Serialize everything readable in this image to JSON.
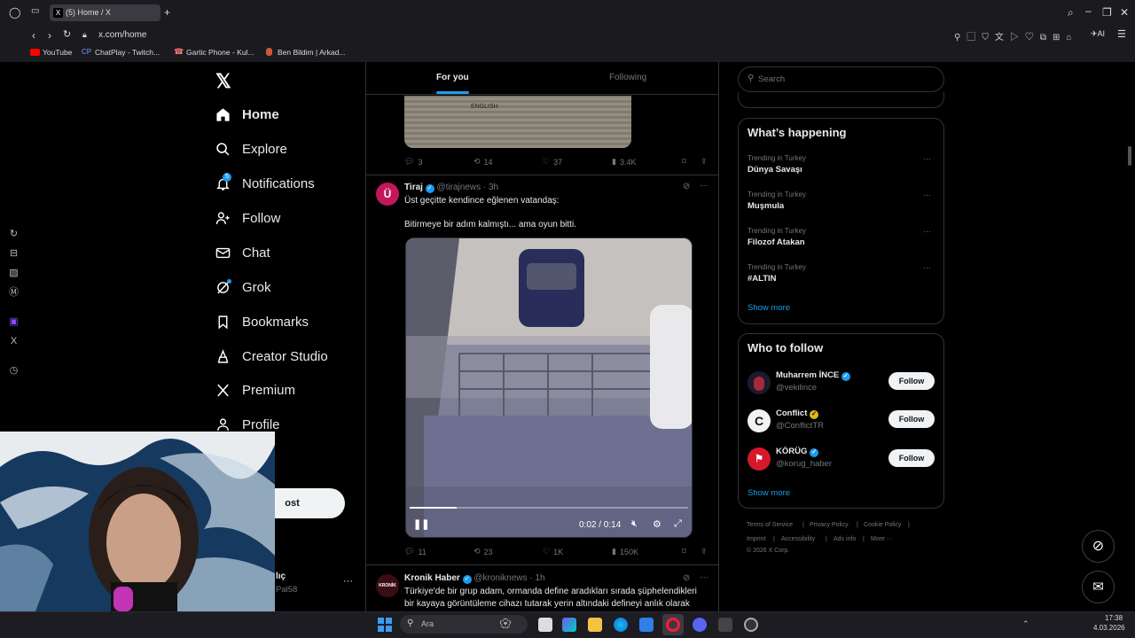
{
  "browser": {
    "tab_title": "(5) Home / X",
    "url": "x.com/home",
    "bookmarks": [
      "YouTube",
      "ChatPlay - Twitch...",
      "Gartic Phone - Kul...",
      "Ben Bildim | Arkad..."
    ]
  },
  "nav": {
    "items": [
      {
        "label": "Home",
        "icon": "home-icon"
      },
      {
        "label": "Explore",
        "icon": "search-icon"
      },
      {
        "label": "Notifications",
        "icon": "bell-icon",
        "badge": "5"
      },
      {
        "label": "Follow",
        "icon": "person-add-icon"
      },
      {
        "label": "Chat",
        "icon": "mail-icon"
      },
      {
        "label": "Grok",
        "icon": "grok-icon"
      },
      {
        "label": "Bookmarks",
        "icon": "bookmark-icon"
      },
      {
        "label": "Creator Studio",
        "icon": "creator-icon"
      },
      {
        "label": "Premium",
        "icon": "x-icon"
      },
      {
        "label": "Profile",
        "icon": "person-icon"
      }
    ],
    "post_button_partial": "ost",
    "account_name_partial": "lıç",
    "account_handle_partial": "Pal58"
  },
  "feed": {
    "tabs": [
      "For you",
      "Following"
    ],
    "prev_post_stats": {
      "replies": "3",
      "reposts": "14",
      "likes": "37",
      "views": "3.4K"
    },
    "posts": [
      {
        "author": "Tiraj",
        "handle": "@tirajnews",
        "time": "· 3h",
        "text_line1": "Üst geçitte kendince eğlenen vatandaş:",
        "text_line2": "Bitirmeye bir adım kalmıştı... ama oyun bitti.",
        "video_time": "0:02 / 0:14",
        "video_progress": 0.17,
        "stats": {
          "replies": "11",
          "reposts": "23",
          "likes": "1K",
          "views": "150K"
        }
      },
      {
        "author": "Kronik Haber",
        "handle": "@kroniknews",
        "time": "· 1h",
        "text_line1": "Türkiye'de bir grup adam, ormanda define aradıkları sırada şüphelendikleri",
        "text_line2": "bir kayaya görüntüleme cihazı tutarak yerin altındaki defineyi anlık olarak"
      }
    ]
  },
  "right": {
    "search_placeholder": "Search",
    "whats_happening": "What’s happening",
    "trends": [
      {
        "context": "Trending in Turkey",
        "title": "Dünya Savaşı"
      },
      {
        "context": "Trending in Turkey",
        "title": "Muşmula"
      },
      {
        "context": "Trending in Turkey",
        "title": "Filozof Atakan"
      },
      {
        "context": "Trending in Turkey",
        "title": "#ALTIN"
      }
    ],
    "show_more": "Show more",
    "who_to_follow": "Who to follow",
    "suggestions": [
      {
        "name": "Muharrem İNCE",
        "handle": "@vekilince",
        "verified": "blue"
      },
      {
        "name": "Conflict",
        "handle": "@ConflictTR",
        "verified": "gold"
      },
      {
        "name": "KÖRÜG",
        "handle": "@korug_haber",
        "verified": "blue"
      }
    ],
    "follow_label": "Follow",
    "footer": [
      "Terms of Service",
      "|",
      "Privacy Policy",
      "|",
      "Cookie Policy",
      "|",
      "Imprint",
      "|",
      "Accessibility",
      "|",
      "Ads info",
      "|",
      "More ···",
      "© 2026 X Corp."
    ]
  },
  "taskbar": {
    "search_placeholder": "Ara",
    "clock_time": "17:38",
    "clock_date": "4.03.2026"
  },
  "colors": {
    "accent": "#1d9bf0",
    "gold": "#e2b719",
    "border": "#2f3336"
  }
}
